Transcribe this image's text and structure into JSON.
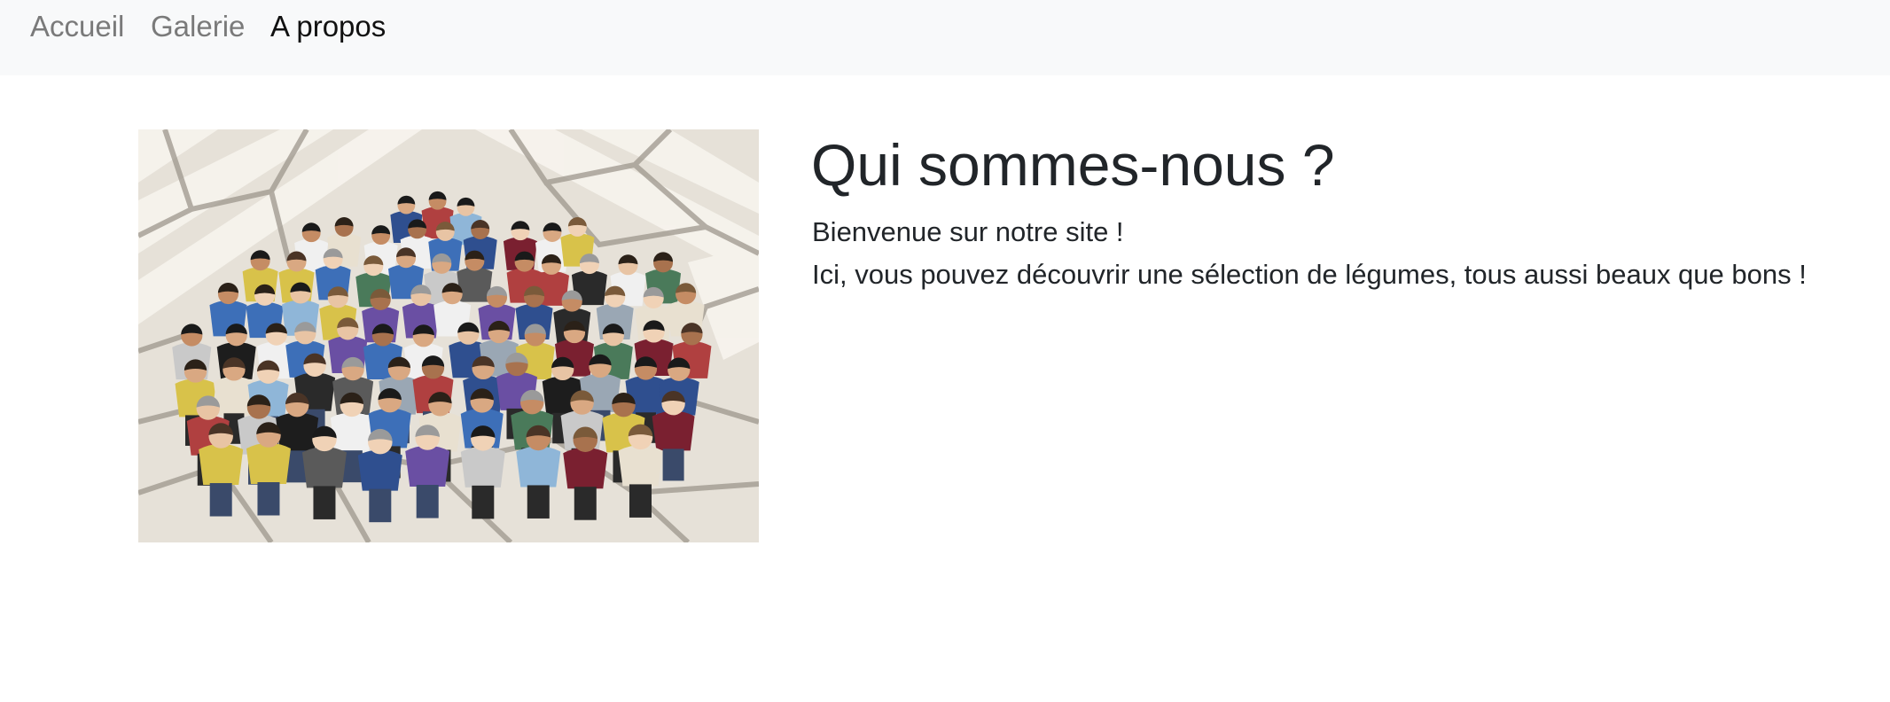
{
  "nav": {
    "items": [
      {
        "label": "Accueil"
      },
      {
        "label": "Galerie"
      },
      {
        "label": "A propos"
      }
    ],
    "active_index": 2
  },
  "main": {
    "heading": "Qui sommes-nous ?",
    "paragraphs": [
      "Bienvenue sur notre site !",
      "Ici, vous pouvez découvrir une sélection de légumes, tous aussi beaux que bons !"
    ],
    "photo": {
      "subject": "group-photo"
    }
  },
  "colors": {
    "navbar_bg": "#f8f9fa",
    "nav_inactive": "#7a7a7a",
    "nav_active": "#111111",
    "text": "#212529"
  }
}
